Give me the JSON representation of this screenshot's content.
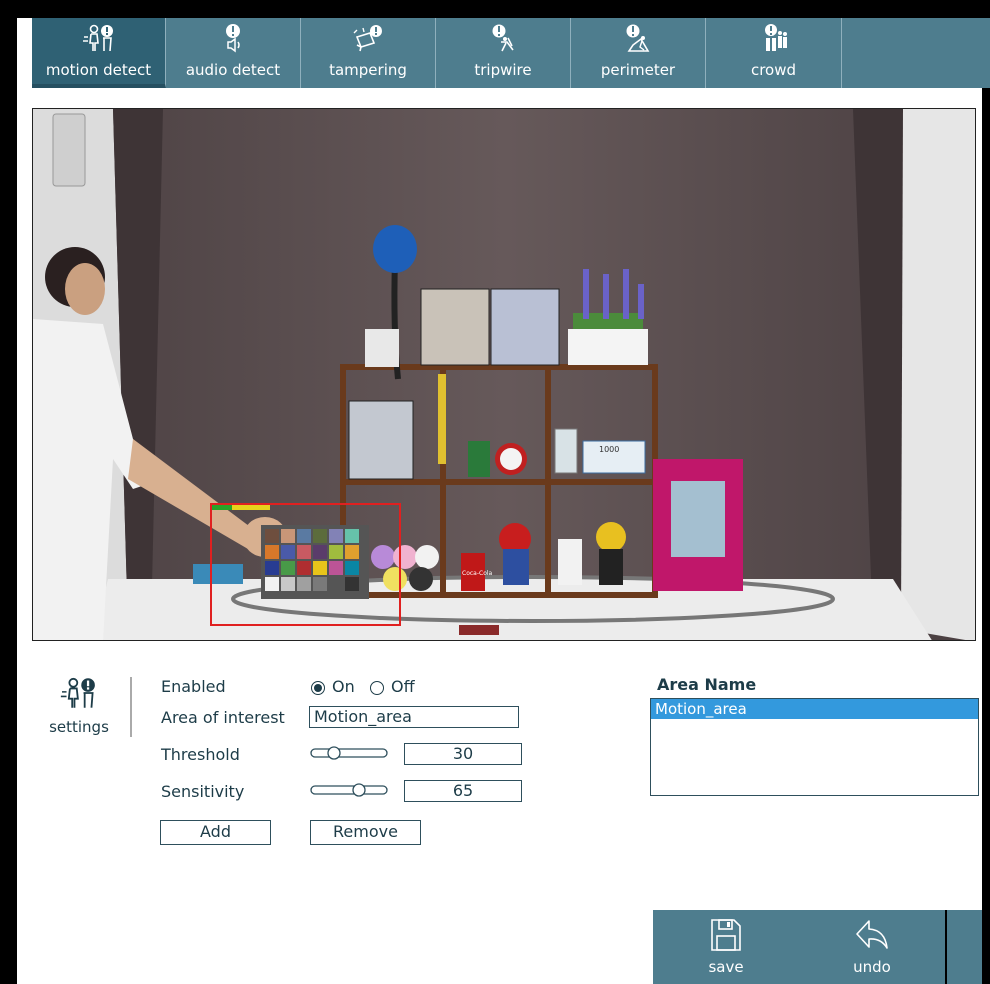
{
  "tabs": [
    {
      "label": "motion detect",
      "icon": "motion-detect-icon",
      "active": true
    },
    {
      "label": "audio detect",
      "icon": "audio-detect-icon",
      "active": false
    },
    {
      "label": "tampering",
      "icon": "tampering-icon",
      "active": false
    },
    {
      "label": "tripwire",
      "icon": "tripwire-icon",
      "active": false
    },
    {
      "label": "perimeter",
      "icon": "perimeter-icon",
      "active": false
    },
    {
      "label": "crowd",
      "icon": "crowd-icon",
      "active": false
    }
  ],
  "camera": {
    "price_tag": "1000",
    "can_label": "Coca-Cola"
  },
  "settings": {
    "label": "settings",
    "enabled_label": "Enabled",
    "on_label": "On",
    "off_label": "Off",
    "enabled_value": "On",
    "area_label": "Area of interest",
    "area_value": "Motion_area",
    "threshold_label": "Threshold",
    "threshold_value": "30",
    "sensitivity_label": "Sensitivity",
    "sensitivity_value": "65",
    "add_label": "Add",
    "remove_label": "Remove"
  },
  "area_list": {
    "title": "Area Name",
    "items": [
      "Motion_area"
    ],
    "selected": "Motion_area"
  },
  "toolbar": {
    "save_label": "save",
    "undo_label": "undo"
  },
  "colors": {
    "tab_bg": "#4e7d8e",
    "tab_active": "#2f6174",
    "selection": "#3399dd",
    "roi_box": "#e02020"
  }
}
